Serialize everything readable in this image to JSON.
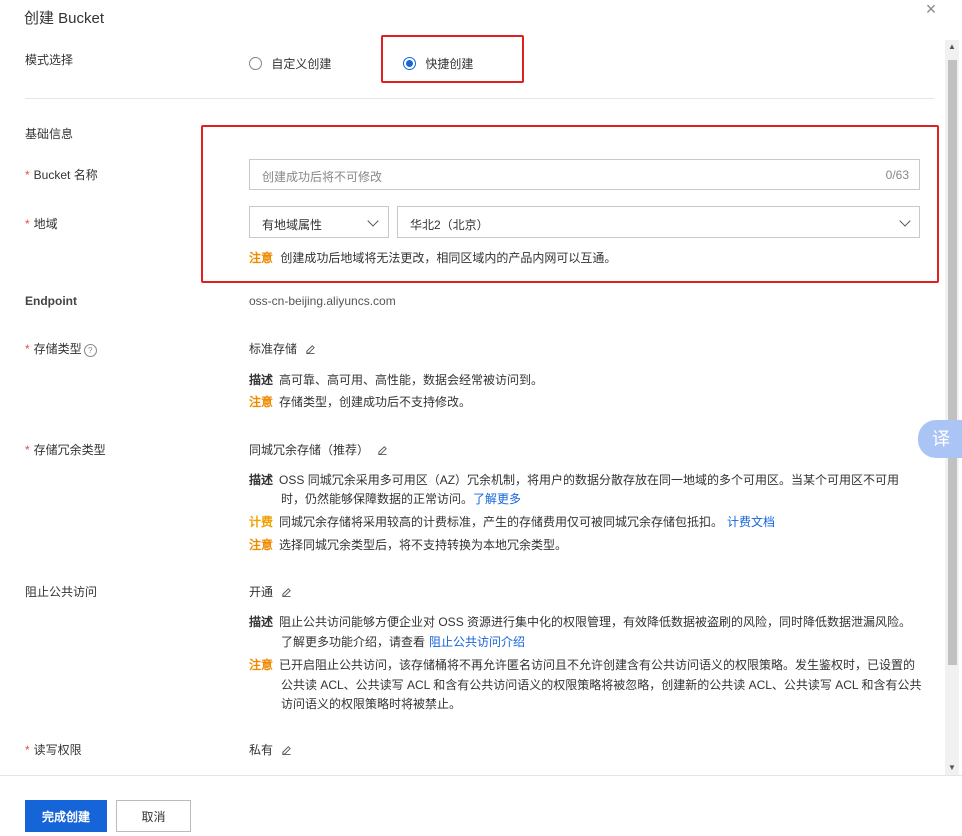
{
  "dialog": {
    "title": "创建 Bucket",
    "close": "×"
  },
  "mode": {
    "label": "模式选择",
    "options": [
      "自定义创建",
      "快捷创建"
    ],
    "selected": "快捷创建"
  },
  "basic": {
    "section": "基础信息"
  },
  "bucket_name": {
    "label": "Bucket 名称",
    "placeholder": "创建成功后将不可修改",
    "counter": "0/63"
  },
  "region": {
    "label": "地域",
    "attr_value": "有地域属性",
    "region_value": "华北2（北京）",
    "note_tag": "注意",
    "note": "创建成功后地域将无法更改，相同区域内的产品内网可以互通。"
  },
  "endpoint": {
    "label": "Endpoint",
    "value": "oss-cn-beijing.aliyuncs.com"
  },
  "storage_class": {
    "label": "存储类型",
    "help": "?",
    "value": "标准存储",
    "desc_tag": "描述",
    "desc": "高可靠、高可用、高性能，数据会经常被访问到。",
    "warn_tag": "注意",
    "warn": "存储类型，创建成功后不支持修改。"
  },
  "redundancy": {
    "label": "存储冗余类型",
    "value": "同城冗余存储（推荐）",
    "desc_tag": "描述",
    "desc1": "OSS 同城冗余采用多可用区（AZ）冗余机制，将用户的数据分散存放在同一地域的多个可用区。当某个可用区不可用",
    "desc2": "时，仍然能够保障数据的正常访问。",
    "desc_link": "了解更多",
    "fee_tag": "计费",
    "fee": "同城冗余存储将采用较高的计费标准，产生的存储费用仅可被同城冗余存储包抵扣。",
    "fee_link": "计费文档",
    "warn_tag": "注意",
    "warn": "选择同城冗余类型后，将不支持转换为本地冗余类型。"
  },
  "block_public": {
    "label": "阻止公共访问",
    "value": "开通",
    "desc_tag": "描述",
    "desc1": "阻止公共访问能够方便企业对 OSS 资源进行集中化的权限管理，有效降低数据被盗刷的风险，同时降低数据泄漏风险。",
    "desc2": "了解更多功能介绍，请查看",
    "desc_link": "阻止公共访问介绍",
    "warn_tag": "注意",
    "warn1": "已开启阻止公共访问，该存储桶将不再允许匿名访问且不允许创建含有公共访问语义的权限策略。发生鉴权时，已设置的",
    "warn2": "公共读 ACL、公共读写 ACL 和含有公共访问语义的权限策略将被忽略，创建新的公共读 ACL、公共读写 ACL 和含有公共",
    "warn3": "访问语义的权限策略时将被禁止。"
  },
  "acl": {
    "label": "读写权限",
    "value": "私有"
  },
  "footer": {
    "confirm": "完成创建",
    "cancel": "取消"
  },
  "translate": {
    "label": "译"
  },
  "colors": {
    "primary": "#1665d8",
    "highlight_box": "#e02020",
    "warning": "#f08a00",
    "required": "#e34d4d"
  }
}
